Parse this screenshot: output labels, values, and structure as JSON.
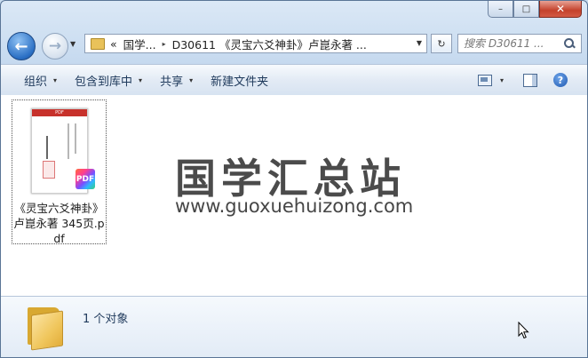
{
  "window": {
    "caption_buttons": {
      "minimize": "–",
      "maximize": "□",
      "close": "✕"
    }
  },
  "nav": {
    "back_glyph": "←",
    "forward_glyph": "→",
    "address_segments": [
      "«",
      "国学...",
      "D30611 《灵宝六爻神卦》卢崑永著 ..."
    ],
    "address_separator": "▸",
    "refresh_glyph": "↻",
    "search_placeholder": "搜索 D30611 ..."
  },
  "command_bar": {
    "items": [
      {
        "label": "组织",
        "has_menu": true
      },
      {
        "label": "包含到库中",
        "has_menu": true
      },
      {
        "label": "共享",
        "has_menu": true
      },
      {
        "label": "新建文件夹",
        "has_menu": false
      }
    ],
    "dropdown_glyph": "▾",
    "help_glyph": "?"
  },
  "content": {
    "files": [
      {
        "name": "《灵宝六爻神卦》卢崑永著 345页.pdf",
        "type": "pdf",
        "badge": "PDF",
        "thumb_header": "PDF"
      }
    ],
    "watermark": {
      "title": "国学汇总站",
      "url": "www.guoxuehuizong.com"
    }
  },
  "details": {
    "status": "1 个对象"
  },
  "icons": [
    "back-icon",
    "forward-icon",
    "folder-icon",
    "refresh-icon",
    "search-icon",
    "views-icon",
    "preview-pane-icon",
    "help-icon",
    "pdf-icon",
    "mouse-cursor-icon"
  ]
}
